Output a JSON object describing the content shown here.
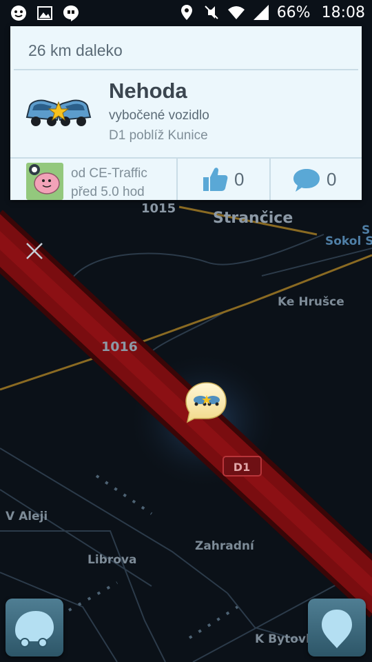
{
  "status_bar": {
    "battery": "66%",
    "time": "18:08"
  },
  "alert_card": {
    "distance": "26 km daleko",
    "title": "Nehoda",
    "subtitle": "vybočené vozidlo",
    "location": "D1 poblíž Kunice",
    "reporter_from": "od CE-Traffic",
    "reporter_time": "před 5.0 hod",
    "thumbs_count": "0",
    "comments_count": "0"
  },
  "map": {
    "labels": {
      "road_1015": "1015",
      "strancice": "Strančice",
      "sokol": "Sokol St",
      "s_cut": "S",
      "ke_hrusce": "Ke Hrušce",
      "road_1016": "1016",
      "d1_shield": "D1",
      "v_aleji": "V Aleji",
      "librova": "Librova",
      "zahradni": "Zahradní",
      "k_bytovk": "K Bytovk"
    },
    "colors": {
      "background": "#0b1118",
      "highway": "#7a0d10",
      "minor_road": "#2c3b4a",
      "yellow_road": "#8a6a22"
    }
  },
  "icons": {
    "accident": "car-crash-icon",
    "close": "close-icon",
    "thumbs_up": "thumbs-up-icon",
    "comment": "comment-icon",
    "menu": "waze-menu-icon",
    "report": "report-pin-icon"
  }
}
